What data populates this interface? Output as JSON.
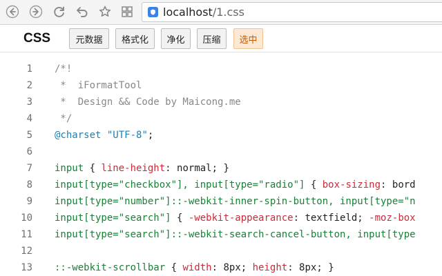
{
  "browser": {
    "url_host": "localhost",
    "url_path": "/1.css",
    "nav_icons": [
      "back-icon",
      "forward-icon",
      "reload-icon",
      "undo-icon",
      "star-icon",
      "apps-icon"
    ]
  },
  "toolbar": {
    "title": "CSS",
    "buttons": [
      {
        "label": "元数据",
        "active": false
      },
      {
        "label": "格式化",
        "active": false
      },
      {
        "label": "净化",
        "active": false
      },
      {
        "label": "压缩",
        "active": false
      },
      {
        "label": "选中",
        "active": true
      }
    ]
  },
  "colors": {
    "comment": "#888888",
    "at_rule": "#1f7fb5",
    "string": "#1f7fb5",
    "selector": "#1a7f37",
    "property": "#cc2a3a",
    "active_button_bg": "#fde9d3",
    "active_button_text": "#c45a00"
  },
  "code": {
    "lines": [
      {
        "n": "1",
        "tokens": [
          {
            "t": "/*!",
            "k": "comment"
          }
        ]
      },
      {
        "n": "2",
        "tokens": [
          {
            "t": " *  iFormatTool",
            "k": "comment"
          }
        ]
      },
      {
        "n": "3",
        "tokens": [
          {
            "t": " *  Design && Code by Maicong.me",
            "k": "comment"
          }
        ]
      },
      {
        "n": "4",
        "tokens": [
          {
            "t": " */",
            "k": "comment"
          }
        ]
      },
      {
        "n": "5",
        "tokens": [
          {
            "t": "@charset",
            "k": "at"
          },
          {
            "t": " ",
            "k": "punc"
          },
          {
            "t": "\"UTF-8\"",
            "k": "str"
          },
          {
            "t": ";",
            "k": "punc"
          }
        ]
      },
      {
        "n": "6",
        "tokens": []
      },
      {
        "n": "7",
        "tokens": [
          {
            "t": "input",
            "k": "sel"
          },
          {
            "t": " { ",
            "k": "punc"
          },
          {
            "t": "line-height",
            "k": "prop"
          },
          {
            "t": ": normal; }",
            "k": "val"
          }
        ]
      },
      {
        "n": "8",
        "tokens": [
          {
            "t": "input[type=\"checkbox\"], input[type=\"radio\"]",
            "k": "sel"
          },
          {
            "t": " { ",
            "k": "punc"
          },
          {
            "t": "box-sizing",
            "k": "prop"
          },
          {
            "t": ": bord",
            "k": "val"
          }
        ]
      },
      {
        "n": "9",
        "tokens": [
          {
            "t": "input[type=\"number\"]::-webkit-inner-spin-button, input[type=\"n",
            "k": "sel"
          }
        ]
      },
      {
        "n": "10",
        "tokens": [
          {
            "t": "input[type=\"search\"]",
            "k": "sel"
          },
          {
            "t": " { ",
            "k": "punc"
          },
          {
            "t": "-webkit-appearance",
            "k": "prop"
          },
          {
            "t": ": textfield; ",
            "k": "val"
          },
          {
            "t": "-moz-box",
            "k": "prop"
          }
        ]
      },
      {
        "n": "11",
        "tokens": [
          {
            "t": "input[type=\"search\"]::-webkit-search-cancel-button, input[type",
            "k": "sel"
          }
        ]
      },
      {
        "n": "12",
        "tokens": []
      },
      {
        "n": "13",
        "tokens": [
          {
            "t": "::-webkit-scrollbar",
            "k": "sel"
          },
          {
            "t": " { ",
            "k": "punc"
          },
          {
            "t": "width",
            "k": "prop"
          },
          {
            "t": ": 8px; ",
            "k": "val"
          },
          {
            "t": "height",
            "k": "prop"
          },
          {
            "t": ": 8px; }",
            "k": "val"
          }
        ]
      }
    ]
  }
}
